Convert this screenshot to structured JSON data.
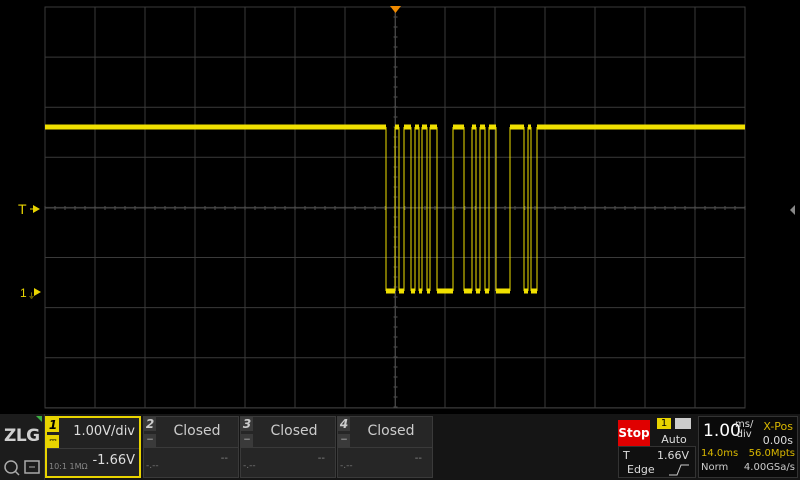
{
  "scope": {
    "trigger_marker_label": "T",
    "channel1_marker_label": "1",
    "trace_color": "#f0e000",
    "grid_color": "#3a3a3a",
    "trigger_position_color": "#f08a00"
  },
  "channels": [
    {
      "num": "1",
      "coupling": "DC",
      "scale": "1.00V/div",
      "offset": "-1.66V",
      "bw": "10:1 1MΩ",
      "state": "active"
    },
    {
      "num": "2",
      "label": "Closed",
      "dash": "--",
      "dash2": "-.--",
      "state": "closed"
    },
    {
      "num": "3",
      "label": "Closed",
      "dash": "--",
      "dash2": "-.--",
      "state": "closed"
    },
    {
      "num": "4",
      "label": "Closed",
      "dash": "--",
      "dash2": "-.--",
      "state": "closed"
    }
  ],
  "logo": {
    "text": "ZLG"
  },
  "run_control": {
    "label": "Stop",
    "color": "#e00000"
  },
  "trigger": {
    "source": "1",
    "mode": "Auto",
    "T_label": "T",
    "level": "1.66V",
    "type": "Edge"
  },
  "timebase": {
    "value": "1.00",
    "unit_top": "ms/",
    "unit_bottom": "div",
    "xpos_label": "X-Pos",
    "xpos_value": "0.00s",
    "duration": "14.0ms",
    "memory": "56.0Mpts",
    "acq_mode": "Norm",
    "sample_rate": "4.00GSa/s"
  }
}
